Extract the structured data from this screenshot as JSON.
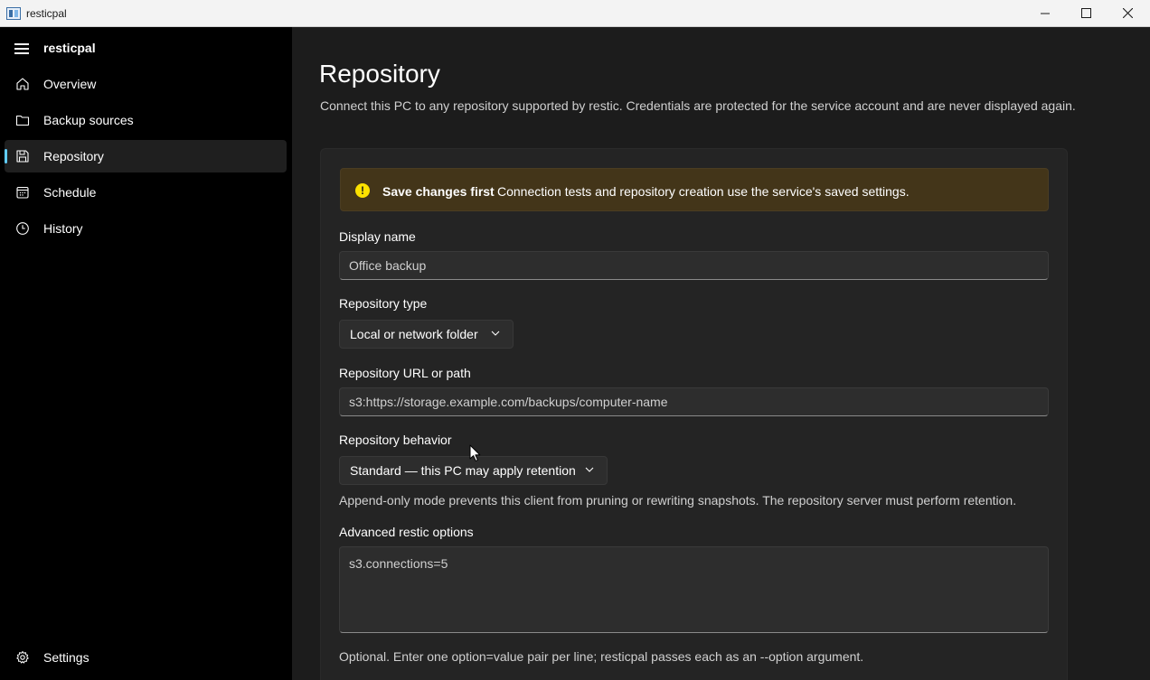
{
  "window": {
    "title": "resticpal"
  },
  "sidebar": {
    "app_name": "resticpal",
    "items": [
      {
        "label": "Overview",
        "icon": "home-icon",
        "active": false
      },
      {
        "label": "Backup sources",
        "icon": "folder-icon",
        "active": false
      },
      {
        "label": "Repository",
        "icon": "save-icon",
        "active": true
      },
      {
        "label": "Schedule",
        "icon": "calendar-icon",
        "active": false
      },
      {
        "label": "History",
        "icon": "clock-icon",
        "active": false
      }
    ],
    "settings_label": "Settings"
  },
  "page": {
    "title": "Repository",
    "description": "Connect this PC to any repository supported by restic. Credentials are protected for the service account and are never displayed again."
  },
  "infobar": {
    "title": "Save changes first",
    "message": "Connection tests and repository creation use the service's saved settings.",
    "icon": "warning-icon"
  },
  "form": {
    "display_name": {
      "label": "Display name",
      "value": "Office backup"
    },
    "repository_type": {
      "label": "Repository type",
      "value": "Local or network folder"
    },
    "repository_url": {
      "label": "Repository URL or path",
      "value": "s3:https://storage.example.com/backups/computer-name"
    },
    "repository_behavior": {
      "label": "Repository behavior",
      "value": "Standard — this PC may apply retention",
      "helper": "Append-only mode prevents this client from pruning or rewriting snapshots. The repository server must perform retention."
    },
    "advanced_options": {
      "label": "Advanced restic options",
      "value": "s3.connections=5",
      "helper": "Optional. Enter one option=value pair per line; resticpal passes each as an --option argument."
    }
  },
  "colors": {
    "accent": "#60cdff",
    "sidebar_bg": "#000000",
    "main_bg": "#1c1c1c",
    "card_bg": "#242424",
    "infobar_bg": "#433519",
    "warning_icon": "#fce100"
  }
}
